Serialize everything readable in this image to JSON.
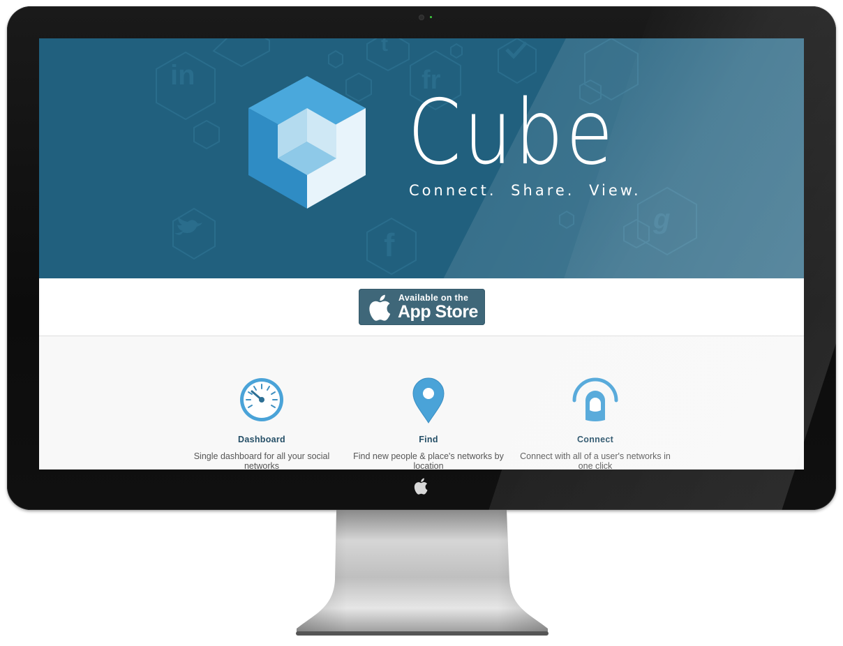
{
  "hero": {
    "title": "Cube",
    "tagline": "Connect.  Share.  View.",
    "background_color": "#21607e",
    "cube_colors": [
      "#4aa8dc",
      "#2f8cc4",
      "#e8f4fb",
      "#b4dbef"
    ]
  },
  "store_button": {
    "line1": "Available on the",
    "line2": "App Store",
    "icon": "apple-icon",
    "color": "#3f6779"
  },
  "features": [
    {
      "icon": "dashboard-gauge-icon",
      "title": "Dashboard",
      "description": "Single dashboard for all your social networks"
    },
    {
      "icon": "location-pin-icon",
      "title": "Find",
      "description": "Find new people & place's networks by location"
    },
    {
      "icon": "connect-touch-icon",
      "title": "Connect",
      "description": "Connect with all of a user's networks in one click"
    }
  ],
  "accent_color": "#4aa3d8",
  "heading_color": "#244e66"
}
